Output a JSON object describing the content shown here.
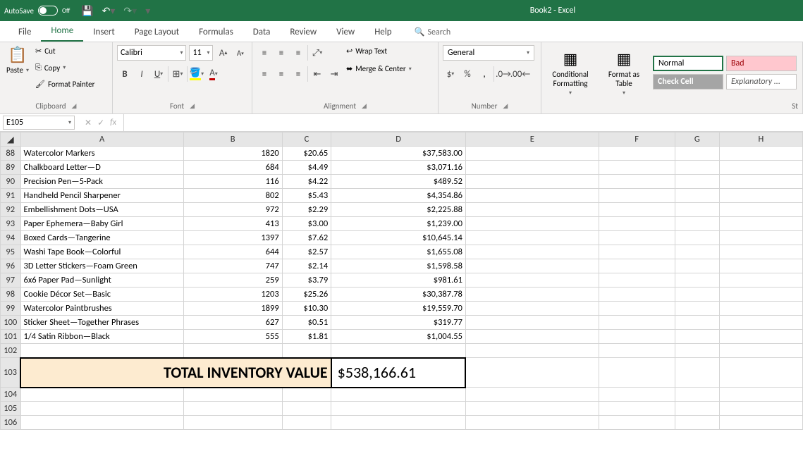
{
  "titlebar": {
    "autosave": "AutoSave",
    "autosave_state": "Off",
    "doc_title": "Book2  -  Excel"
  },
  "tabs": {
    "file": "File",
    "home": "Home",
    "insert": "Insert",
    "pagelayout": "Page Layout",
    "formulas": "Formulas",
    "data": "Data",
    "review": "Review",
    "view": "View",
    "help": "Help",
    "search": "Search"
  },
  "ribbon": {
    "paste": "Paste",
    "cut": "Cut",
    "copy": "Copy",
    "format_painter": "Format Painter",
    "clipboard": "Clipboard",
    "font_group": "Font",
    "font_name": "Calibri",
    "font_size": "11",
    "wrap": "Wrap Text",
    "merge": "Merge & Center",
    "alignment": "Alignment",
    "number_format": "General",
    "number": "Number",
    "cond_fmt": "Conditional\nFormatting",
    "fmt_table": "Format as\nTable",
    "style_normal": "Normal",
    "style_bad": "Bad",
    "style_check": "Check Cell",
    "style_explain": "Explanatory ...",
    "styles": "St"
  },
  "fx": {
    "name_box": "E105",
    "formula": ""
  },
  "columns": [
    "A",
    "B",
    "C",
    "D",
    "E",
    "F",
    "G",
    "H"
  ],
  "rows": [
    {
      "n": 88,
      "a": "Watercolor Markers",
      "b": "1820",
      "c": "$20.65",
      "d": "$37,583.00"
    },
    {
      "n": 89,
      "a": "Chalkboard Letter—D",
      "b": "684",
      "c": "$4.49",
      "d": "$3,071.16"
    },
    {
      "n": 90,
      "a": "Precision Pen—5-Pack",
      "b": "116",
      "c": "$4.22",
      "d": "$489.52"
    },
    {
      "n": 91,
      "a": "Handheld Pencil Sharpener",
      "b": "802",
      "c": "$5.43",
      "d": "$4,354.86"
    },
    {
      "n": 92,
      "a": "Embellishment Dots—USA",
      "b": "972",
      "c": "$2.29",
      "d": "$2,225.88"
    },
    {
      "n": 93,
      "a": "Paper Ephemera—Baby Girl",
      "b": "413",
      "c": "$3.00",
      "d": "$1,239.00"
    },
    {
      "n": 94,
      "a": "Boxed Cards—Tangerine",
      "b": "1397",
      "c": "$7.62",
      "d": "$10,645.14"
    },
    {
      "n": 95,
      "a": "Washi Tape Book—Colorful",
      "b": "644",
      "c": "$2.57",
      "d": "$1,655.08"
    },
    {
      "n": 96,
      "a": "3D Letter Stickers—Foam Green",
      "b": "747",
      "c": "$2.14",
      "d": "$1,598.58"
    },
    {
      "n": 97,
      "a": "6x6 Paper Pad—Sunlight",
      "b": "259",
      "c": "$3.79",
      "d": "$981.61"
    },
    {
      "n": 98,
      "a": "Cookie Décor Set—Basic",
      "b": "1203",
      "c": "$25.26",
      "d": "$30,387.78"
    },
    {
      "n": 99,
      "a": "Watercolor Paintbrushes",
      "b": "1899",
      "c": "$10.30",
      "d": "$19,559.70"
    },
    {
      "n": 100,
      "a": "Sticker Sheet—Together Phrases",
      "b": "627",
      "c": "$0.51",
      "d": "$319.77"
    },
    {
      "n": 101,
      "a": "1/4 Satin Ribbon—Black",
      "b": "555",
      "c": "$1.81",
      "d": "$1,004.55"
    }
  ],
  "total": {
    "label": "TOTAL INVENTORY VALUE",
    "value": "$538,166.61"
  },
  "empty_rows": [
    102,
    104,
    105,
    106
  ],
  "total_row_n": 103
}
